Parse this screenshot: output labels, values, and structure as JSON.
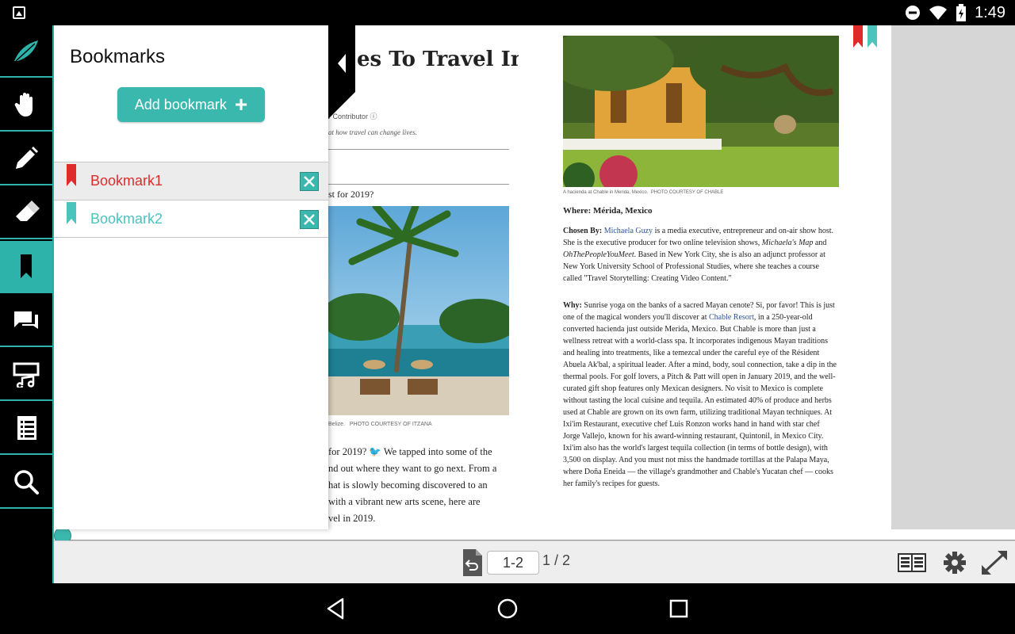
{
  "status_bar": {
    "time": "1:49",
    "icons": [
      "gallery-icon",
      "dnd-icon",
      "wifi-icon",
      "battery-icon"
    ]
  },
  "toolbar": {
    "items": [
      {
        "name": "app-logo-icon"
      },
      {
        "name": "pan-hand-icon"
      },
      {
        "name": "pencil-icon"
      },
      {
        "name": "eraser-icon"
      },
      {
        "name": "bookmark-icon",
        "active": true
      },
      {
        "name": "comments-icon"
      },
      {
        "name": "media-icon"
      },
      {
        "name": "toc-list-icon"
      },
      {
        "name": "search-icon"
      }
    ],
    "accent_color": "#2eb3aa"
  },
  "bookmarks_panel": {
    "title": "Bookmarks",
    "add_button_label": "Add bookmark",
    "items": [
      {
        "label": "Bookmark1",
        "color": "#e02b2b",
        "selected": true
      },
      {
        "label": "Bookmark2",
        "color": "#4cc3bd",
        "selected": false
      }
    ]
  },
  "document": {
    "left_page": {
      "title_fragment": "es To Travel In",
      "byline_fragment": "r Contributor ⓘ",
      "subline_fragment": "at how travel can change lives.",
      "question_fragment": "st for 2019?",
      "caption_fragment": "Belize.",
      "caption_credit": "PHOTO COURTESY OF ITZANA",
      "paragraph_lines": [
        "for 2019?",
        "We tapped into some of the",
        "nd out where they want to go next. From a",
        "hat is slowly becoming discovered to an",
        "with a vibrant new arts scene, here are",
        "vel in 2019."
      ]
    },
    "right_page": {
      "caption": "A hacienda at Chable in Merida, Mexico.",
      "caption_credit": "PHOTO COURTESY OF CHABLE",
      "where": "Where: Mérida, Mexico",
      "chosen_by_label": "Chosen By:",
      "chosen_by_link": "Michaela Guzy",
      "chosen_by_text_1": "is a media executive, entrepreneur and on-air show host. She is the executive producer for two online television shows,",
      "show_1": "Michaela's Map",
      "and_word": "and",
      "show_2": "OhThePeopleYouMeet",
      "chosen_by_text_2": ". Based in New York City, she is also an adjunct professor at New York University School of Professional Studies, where she teaches a course called \"Travel Storytelling: Creating Video Content.\"",
      "why_label": "Why:",
      "why_text_1": "Sunrise yoga on the banks of a sacred Mayan cenote? Si, por favor! This is just one of the magical wonders you'll discover at",
      "why_link": "Chable Resort",
      "why_text_2": ", in a 250-year-old converted hacienda just outside Merida, Mexico. But Chable is more than just a wellness retreat with a world-class spa. It incorporates indigenous Mayan traditions and healing into treatments, like a temezcal under the careful eye of the Résident Abuela Ak'bal, a spiritual leader. After a mind, body, soul connection, take a dip in the thermal pools. For golf lovers, a Pitch & Patt will open in January 2019, and the well-curated gift shop features only Mexican designers. No visit to Mexico is complete without tasting the local cuisine and tequila. An estimated 40% of produce and herbs used at Chable are grown on its own farm, utilizing traditional Mayan techniques. At Ixi'im Restaurant, executive chef Luis Ronzon works hand in hand with star chef Jorge Vallejo, known for his award-winning restaurant, Quintonil, in Mexico City. Ixi'im also has the world's largest tequila collection (in terms of bottle design), with 3,500 on display. And you must not miss the handmade tortillas at the Palapa Maya, where Doña Eneida — the village's grandmother and Chable's Yucatan chef — cooks her family's recipes for guests."
    }
  },
  "bottom_bar": {
    "page_input_value": "1-2",
    "page_total": "1 / 2",
    "scrub_position": 0.0,
    "icons": [
      "undo-page-icon",
      "two-page-view-icon",
      "settings-gear-icon",
      "fullscreen-icon"
    ]
  },
  "nav_bar": {
    "buttons": [
      "back-icon",
      "home-icon",
      "recents-icon"
    ]
  }
}
